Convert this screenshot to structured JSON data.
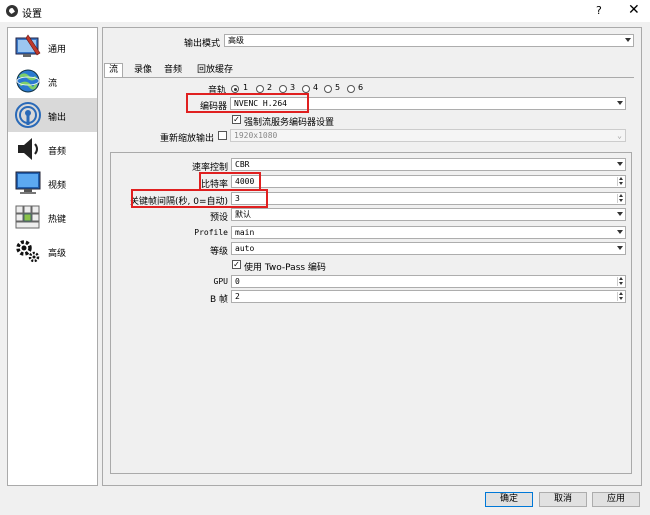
{
  "window": {
    "title": "设置",
    "help_glyph": "?",
    "close_glyph": "✕"
  },
  "sidebar": {
    "items": [
      {
        "label": "通用",
        "icon": "general-icon"
      },
      {
        "label": "流",
        "icon": "stream-icon"
      },
      {
        "label": "输出",
        "icon": "output-icon"
      },
      {
        "label": "音频",
        "icon": "audio-icon"
      },
      {
        "label": "视频",
        "icon": "video-icon"
      },
      {
        "label": "热键",
        "icon": "hotkeys-icon"
      },
      {
        "label": "高级",
        "icon": "advanced-icon"
      }
    ],
    "selected": "输出"
  },
  "output_mode": {
    "label": "输出模式",
    "value": "高级"
  },
  "tabs": [
    "流",
    "录像",
    "音频",
    "回放缓存"
  ],
  "active_tab": "流",
  "audio_track": {
    "label": "音轨",
    "options": [
      "1",
      "2",
      "3",
      "4",
      "5",
      "6"
    ],
    "selected": "1"
  },
  "encoder": {
    "label": "编码器",
    "value": "NVENC H.264"
  },
  "enforce_service": {
    "label": "强制流服务编码器设置",
    "checked": true
  },
  "rescale": {
    "label": "重新缩放输出",
    "checked": false,
    "value": "1920x1080"
  },
  "settings": {
    "rate_control": {
      "label": "速率控制",
      "value": "CBR"
    },
    "bitrate": {
      "label": "比特率",
      "value": "4000"
    },
    "keyframe": {
      "label": "关键帧间隔(秒, 0=自动)",
      "value": "3"
    },
    "preset": {
      "label": "预设",
      "value": "默认"
    },
    "profile": {
      "label": "Profile",
      "value": "main"
    },
    "level": {
      "label": "等级",
      "value": "auto"
    },
    "two_pass": {
      "label": "使用 Two-Pass 编码",
      "checked": true
    },
    "gpu": {
      "label": "GPU",
      "value": "0"
    },
    "bframes": {
      "label": "B 帧",
      "value": "2"
    }
  },
  "buttons": {
    "ok": "确定",
    "cancel": "取消",
    "apply": "应用"
  },
  "colors": {
    "highlight_box": "#e02020",
    "selected_item_bg": "#d9d9d9",
    "default_button_border": "#0078d7"
  }
}
